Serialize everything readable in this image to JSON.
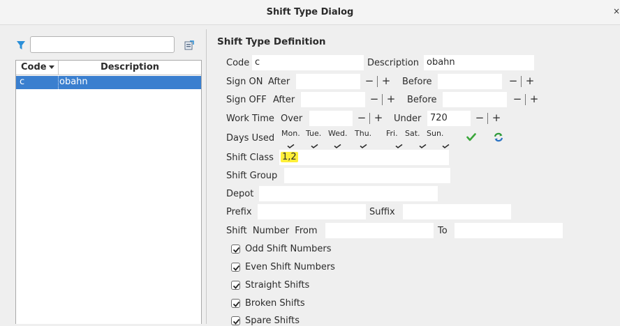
{
  "window": {
    "title": "Shift Type Dialog",
    "close_label": "×"
  },
  "left_panel": {
    "filter_value": "",
    "table": {
      "columns": [
        "Code",
        "Description"
      ],
      "rows": [
        {
          "code": "c",
          "description": "obahn"
        }
      ]
    }
  },
  "form": {
    "section_title": "Shift Type Definition",
    "code_label": "Code",
    "code_value": "c",
    "description_label": "Description",
    "description_value": "obahn",
    "sign_on_label": "Sign ON",
    "sign_off_label": "Sign OFF",
    "after_label": "After",
    "before_label": "Before",
    "sign_on_after": "",
    "sign_on_before": "",
    "sign_off_after": "",
    "sign_off_before": "",
    "work_time_label": "Work Time",
    "over_label": "Over",
    "under_label": "Under",
    "work_over": "",
    "work_under": "720",
    "minus": "−",
    "plus": "+",
    "days_used_label": "Days Used",
    "days": [
      "Mon.",
      "Tue.",
      "Wed.",
      "Thu.",
      "Fri.",
      "Sat.",
      "Sun."
    ],
    "shift_class_label": "Shift Class",
    "shift_class_value": "1,2",
    "shift_group_label": "Shift Group",
    "shift_group_value": "",
    "depot_label": "Depot",
    "depot_value": "",
    "prefix_label": "Prefix",
    "prefix_value": "",
    "suffix_label": "Suffix",
    "suffix_value": "",
    "shift_number_from_label": "Shift  Number  From",
    "shift_number_from": "",
    "to_label": "To",
    "shift_number_to": "",
    "options": [
      {
        "label": "Odd Shift Numbers",
        "checked": true
      },
      {
        "label": "Even Shift Numbers",
        "checked": true
      },
      {
        "label": "Straight Shifts",
        "checked": true
      },
      {
        "label": "Broken Shifts",
        "checked": true
      },
      {
        "label": "Spare Shifts",
        "checked": true
      }
    ]
  },
  "colors": {
    "selection": "#3a7fcf",
    "highlight": "#ffef3a",
    "check_green": "#3aa63a",
    "filter_blue": "#2a8fd8"
  }
}
